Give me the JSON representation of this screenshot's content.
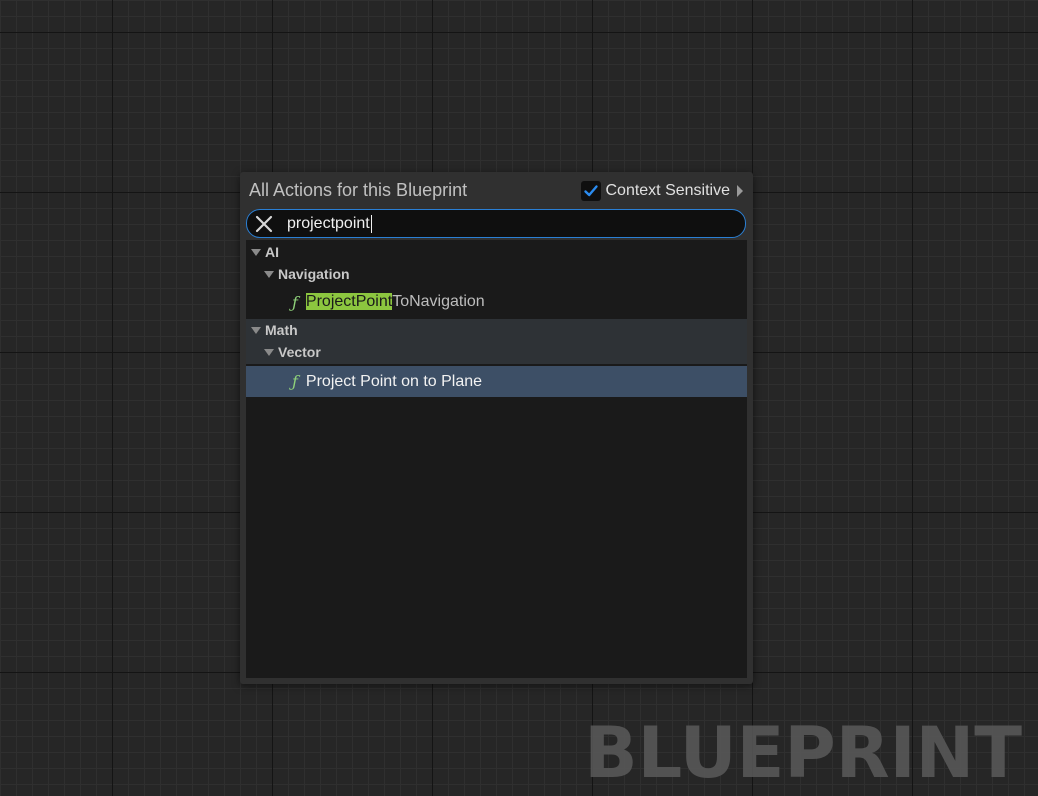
{
  "watermark": "BLUEPRINT",
  "menu": {
    "title": "All Actions for this Blueprint",
    "context_sensitive": {
      "label": "Context Sensitive",
      "checked": true
    },
    "search": {
      "value": "projectpoint"
    },
    "tree": {
      "ai": {
        "label": "AI",
        "navigation": {
          "label": "Navigation",
          "item": {
            "highlight": "ProjectPoint",
            "rest": "ToNavigation"
          }
        }
      },
      "math": {
        "label": "Math",
        "vector": {
          "label": "Vector",
          "item": {
            "label": "Project Point on to Plane"
          }
        }
      }
    }
  },
  "icons": {
    "function": "function-icon",
    "clear": "close-icon",
    "check": "checkmark-icon",
    "expand": "triangle-down-icon",
    "submenu": "triangle-right-icon"
  },
  "colors": {
    "focus_border": "#2a7fd4",
    "match_highlight": "#8cc63f",
    "selected_row": "#3d4f66",
    "function_icon": "#8fd17a"
  }
}
